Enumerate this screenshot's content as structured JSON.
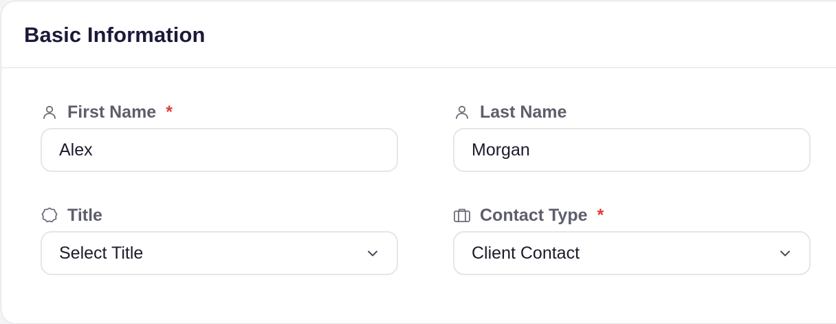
{
  "section": {
    "title": "Basic Information"
  },
  "fields": {
    "first_name": {
      "label": "First Name",
      "required_marker": "*",
      "value": "Alex",
      "icon": "user-icon"
    },
    "last_name": {
      "label": "Last Name",
      "value": "Morgan",
      "icon": "user-icon"
    },
    "title": {
      "label": "Title",
      "selected": "Select Title",
      "icon": "badge-icon"
    },
    "contact_type": {
      "label": "Contact Type",
      "required_marker": "*",
      "selected": "Client Contact",
      "icon": "briefcase-icon"
    }
  },
  "colors": {
    "title_text": "#1c1a3a",
    "label_text": "#5d5e6b",
    "required": "#e03a3a",
    "input_border": "#e6e6ea"
  }
}
